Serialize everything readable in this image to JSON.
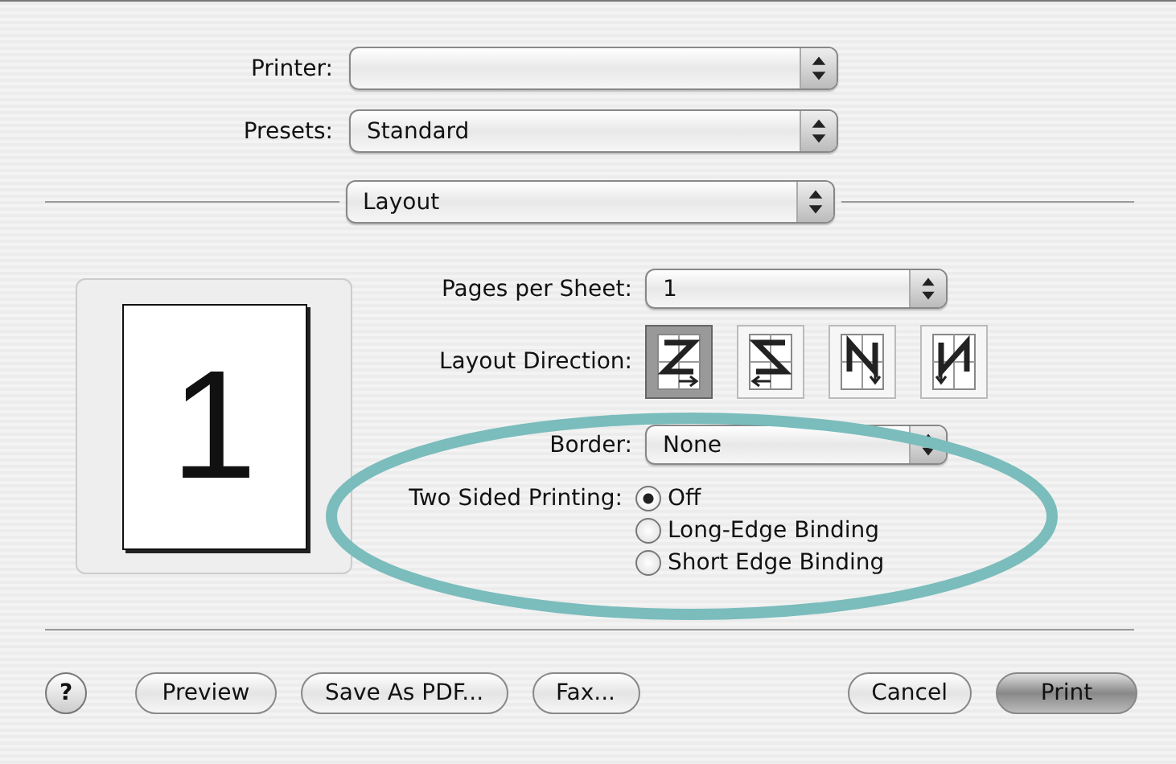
{
  "printer": {
    "label": "Printer:"
  },
  "presets": {
    "label": "Presets:",
    "value": "Standard"
  },
  "panel": {
    "value": "Layout"
  },
  "preview": {
    "page_number": "1"
  },
  "pages_per_sheet": {
    "label": "Pages per Sheet:",
    "value": "1"
  },
  "layout_direction": {
    "label": "Layout Direction:",
    "options": [
      {
        "kind": "z",
        "selected": true
      },
      {
        "kind": "s",
        "selected": false
      },
      {
        "kind": "n",
        "selected": false
      },
      {
        "kind": "nr",
        "selected": false
      }
    ]
  },
  "border": {
    "label": "Border:",
    "value": "None"
  },
  "two_sided": {
    "label": "Two Sided Printing:",
    "options": [
      {
        "label": "Off",
        "selected": true
      },
      {
        "label": "Long-Edge Binding",
        "selected": false
      },
      {
        "label": "Short Edge Binding",
        "selected": false
      }
    ]
  },
  "buttons": [
    {
      "label": "Preview",
      "kind": "normal"
    },
    {
      "label": "Save As PDF...",
      "kind": "normal"
    },
    {
      "label": "Fax...",
      "kind": "normal"
    },
    {
      "label": "Cancel",
      "kind": "normal"
    },
    {
      "label": "Print",
      "kind": "default"
    }
  ],
  "help": {
    "label": "?"
  }
}
